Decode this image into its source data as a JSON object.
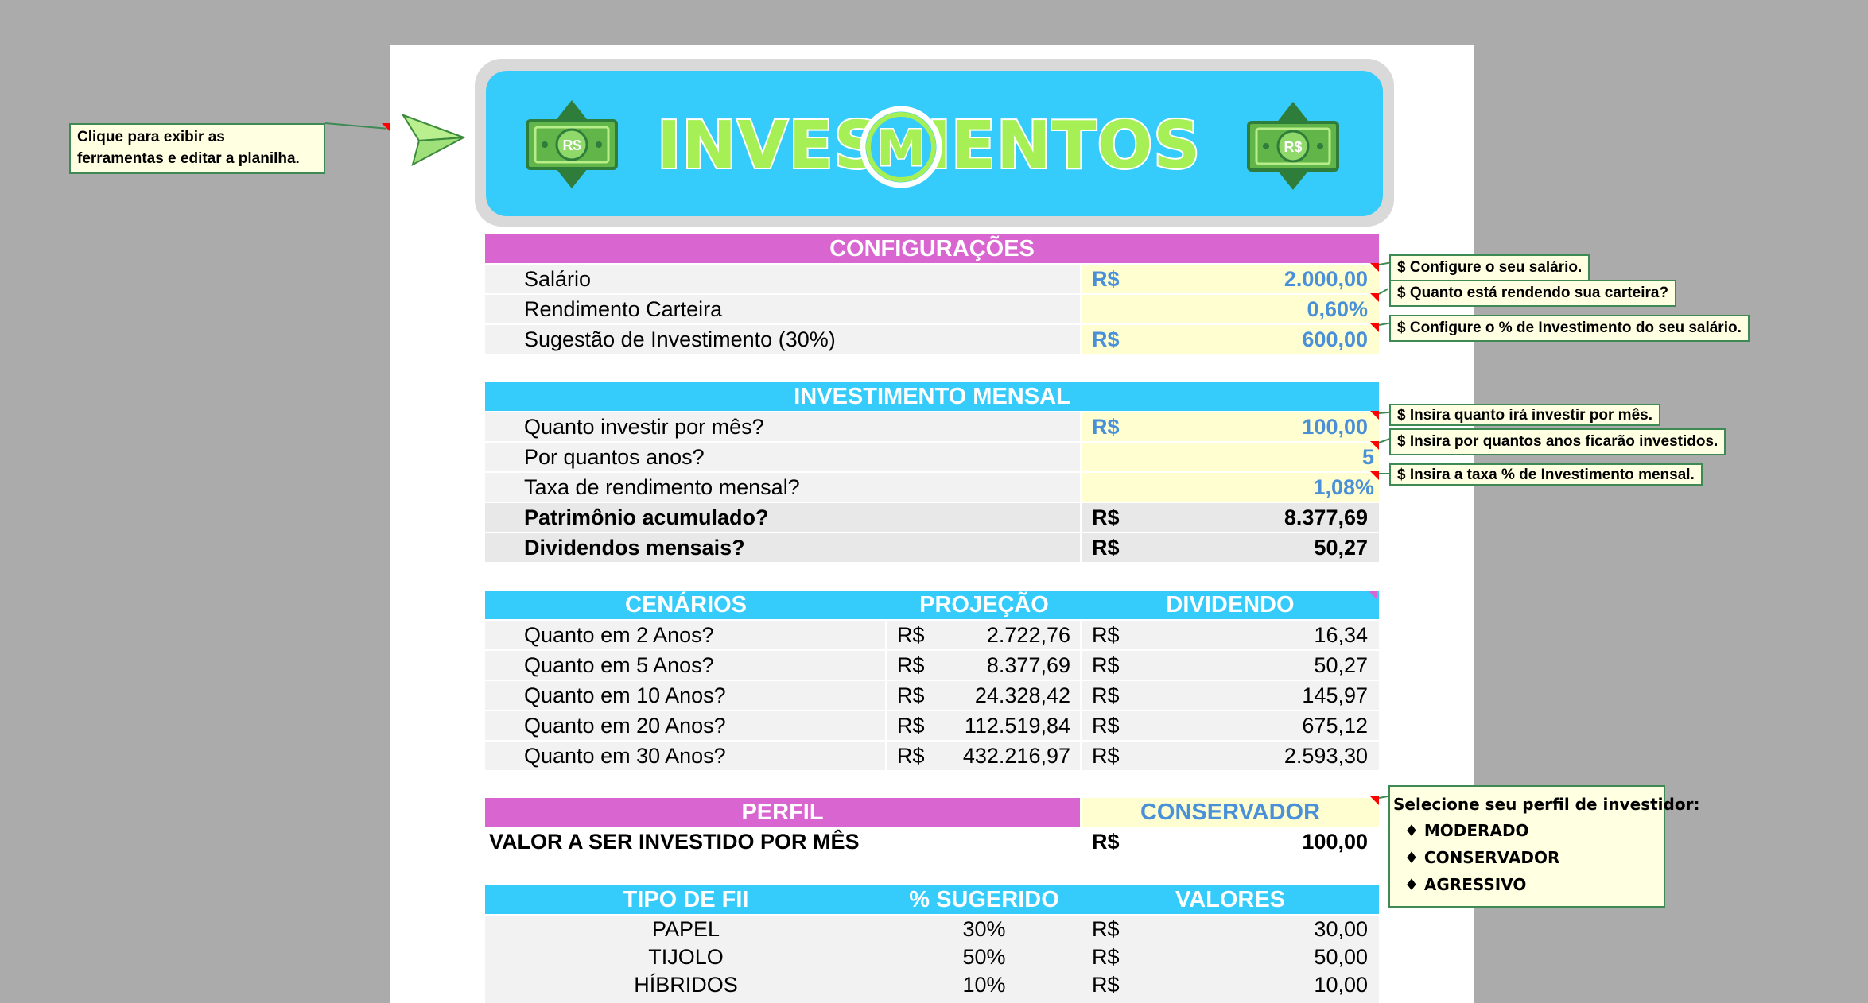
{
  "help_note": "Clique para exibir as\nferramentas e editar a planilha.",
  "banner": {
    "title_left": "INVESTI",
    "title_mid": "M",
    "title_right": "ENTOS",
    "money_label": "R$"
  },
  "config": {
    "header": "CONFIGURAÇÕES",
    "rows": [
      {
        "label": "Salário",
        "currency": "R$",
        "value": "2.000,00",
        "note": "$ Configure o seu salário."
      },
      {
        "label": "Rendimento Carteira",
        "currency": "",
        "value": "0,60%",
        "note": "$ Quanto está rendendo sua carteira?"
      },
      {
        "label": "Sugestão de Investimento (30%)",
        "currency": "R$",
        "value": "600,00",
        "note": "$ Configure o % de Investimento do seu salário."
      }
    ]
  },
  "monthly": {
    "header": "INVESTIMENTO MENSAL",
    "rows": [
      {
        "label": "Quanto investir por mês?",
        "currency": "R$",
        "value": "100,00",
        "note": "$ Insira quanto irá investir por mês."
      },
      {
        "label": "Por quantos anos?",
        "currency": "",
        "value": "5",
        "note": "$ Insira por quantos anos ficarão investidos."
      },
      {
        "label": "Taxa de rendimento mensal?",
        "currency": "",
        "value": "1,08%",
        "note": "$ Insira a taxa % de Investimento mensal."
      },
      {
        "label": "Patrimônio acumulado?",
        "currency": "R$",
        "value": "8.377,69"
      },
      {
        "label": "Dividendos mensais?",
        "currency": "R$",
        "value": "50,27"
      }
    ]
  },
  "scenarios": {
    "headers": [
      "CENÁRIOS",
      "PROJEÇÃO",
      "DIVIDENDO"
    ],
    "rows": [
      {
        "label": "Quanto em 2 Anos?",
        "cur1": "R$",
        "proj": "2.722,76",
        "cur2": "R$",
        "div": "16,34"
      },
      {
        "label": "Quanto em 5 Anos?",
        "cur1": "R$",
        "proj": "8.377,69",
        "cur2": "R$",
        "div": "50,27"
      },
      {
        "label": "Quanto em 10 Anos?",
        "cur1": "R$",
        "proj": "24.328,42",
        "cur2": "R$",
        "div": "145,97"
      },
      {
        "label": "Quanto em 20 Anos?",
        "cur1": "R$",
        "proj": "112.519,84",
        "cur2": "R$",
        "div": "675,12"
      },
      {
        "label": "Quanto em 30 Anos?",
        "cur1": "R$",
        "proj": "432.216,97",
        "cur2": "R$",
        "div": "2.593,30"
      }
    ]
  },
  "profile": {
    "header": "PERFIL",
    "selected": "CONSERVADOR",
    "value_label": "VALOR A SER INVESTIDO POR MÊS",
    "currency": "R$",
    "value": "100,00",
    "note_title": "Selecione seu perfil de investidor:",
    "note_options": [
      "♦ MODERADO",
      "♦ CONSERVADOR",
      "♦ AGRESSIVO"
    ]
  },
  "fii": {
    "headers": [
      "TIPO DE FII",
      "% SUGERIDO",
      "VALORES"
    ],
    "rows": [
      {
        "type": "PAPEL",
        "pct": "30%",
        "currency": "R$",
        "value": "30,00"
      },
      {
        "type": "TIJOLO",
        "pct": "50%",
        "currency": "R$",
        "value": "50,00"
      },
      {
        "type": "HÍBRIDOS",
        "pct": "10%",
        "currency": "R$",
        "value": "10,00"
      }
    ]
  }
}
